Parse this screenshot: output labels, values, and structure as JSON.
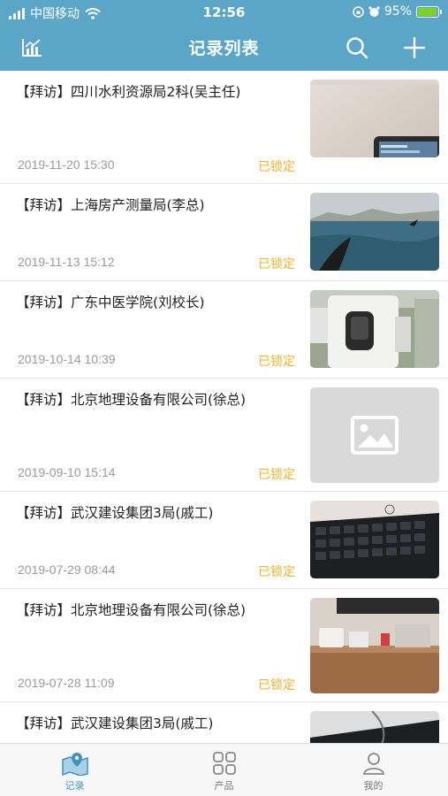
{
  "status_bar": {
    "carrier": "中国移动",
    "time": "12:56",
    "battery": "95%"
  },
  "header": {
    "title": "记录列表"
  },
  "records": [
    {
      "title": "【拜访】四川水利资源局2科(吴主任)",
      "date": "2019-11-20 15:30",
      "status": "已锁定",
      "thumb": "wall-monitor-photo"
    },
    {
      "title": "【拜访】上海房产测量局(李总)",
      "date": "2019-11-13 15:12",
      "status": "已锁定",
      "thumb": "sea-whale-photo"
    },
    {
      "title": "【拜访】广东中医学院(刘校长)",
      "date": "2019-10-14 10:39",
      "status": "已锁定",
      "thumb": "survey-instrument-photo"
    },
    {
      "title": "【拜访】北京地理设备有限公司(徐总)",
      "date": "2019-09-10 15:14",
      "status": "已锁定",
      "thumb": "image-placeholder"
    },
    {
      "title": "【拜访】武汉建设集团3局(戚工)",
      "date": "2019-07-29 08:44",
      "status": "已锁定",
      "thumb": "keyboard-photo"
    },
    {
      "title": "【拜访】北京地理设备有限公司(徐总)",
      "date": "2019-07-28 11:09",
      "status": "已锁定",
      "thumb": "office-desk-photo"
    },
    {
      "title": "【拜访】武汉建设集团3局(戚工)",
      "date": "",
      "status": "",
      "thumb": "cable-photo"
    }
  ],
  "tabs": [
    {
      "label": "记录",
      "icon": "map-pin-icon",
      "active": true
    },
    {
      "label": "产品",
      "icon": "grid-icon",
      "active": false
    },
    {
      "label": "我的",
      "icon": "user-icon",
      "active": false
    }
  ],
  "colors": {
    "header_bg": "#5ba6c6",
    "status_locked": "#f3b12c",
    "tab_active": "#3f93bf"
  }
}
